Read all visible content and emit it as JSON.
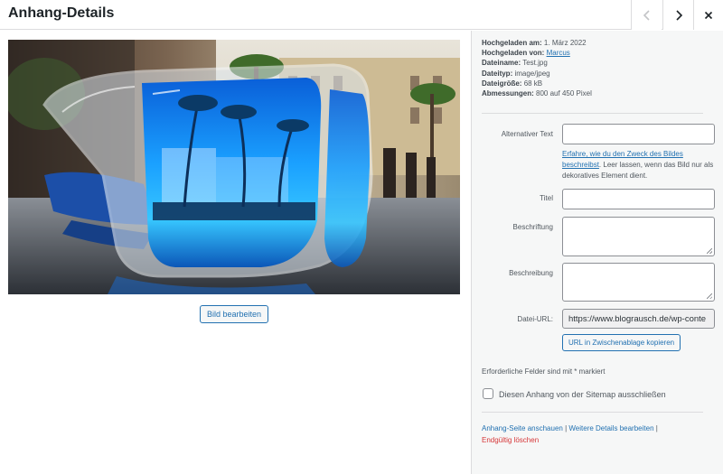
{
  "header": {
    "title": "Anhang-Details",
    "prev_icon": "chevron-left-icon",
    "next_icon": "chevron-right-icon",
    "close_icon": "close-icon"
  },
  "media": {
    "image_alt": "Sunglasses reflecting a plaza with palm trees",
    "edit_button": "Bild bearbeiten"
  },
  "details": {
    "uploaded_on_label": "Hochgeladen am:",
    "uploaded_on_value": "1. März 2022",
    "uploaded_by_label": "Hochgeladen von:",
    "uploaded_by_value": "Marcus",
    "filename_label": "Dateiname:",
    "filename_value": "Test.jpg",
    "filetype_label": "Dateityp:",
    "filetype_value": "image/jpeg",
    "filesize_label": "Dateigröße:",
    "filesize_value": "68 kB",
    "dimensions_label": "Abmessungen:",
    "dimensions_value": "800 auf 450 Pixel"
  },
  "form": {
    "alt_label": "Alternativer Text",
    "alt_value": "",
    "help_link": "Erfahre, wie du den Zweck des Bildes beschreibst",
    "help_text": ". Leer lassen, wenn das Bild nur als dekoratives Element dient.",
    "title_label": "Titel",
    "title_value": "",
    "caption_label": "Beschriftung",
    "caption_value": "",
    "description_label": "Beschreibung",
    "description_value": "",
    "url_label": "Datei-URL:",
    "url_value": "https://www.blograusch.de/wp-conte",
    "copy_button": "URL in Zwischenablage kopieren",
    "required_note": "Erforderliche Felder sind mit * markiert",
    "sitemap_checkbox_label": "Diesen Anhang von der Sitemap ausschließen",
    "sitemap_checked": false
  },
  "actions": {
    "view_page": "Anhang-Seite anschauen",
    "separator": " | ",
    "edit_more": "Weitere Details bearbeiten",
    "trailing_separator": " |",
    "delete": "Endgültig löschen"
  },
  "colors": {
    "link": "#2271b1",
    "delete": "#d63638",
    "sidebar_bg": "#f6f7f7",
    "border": "#dcdcde"
  }
}
